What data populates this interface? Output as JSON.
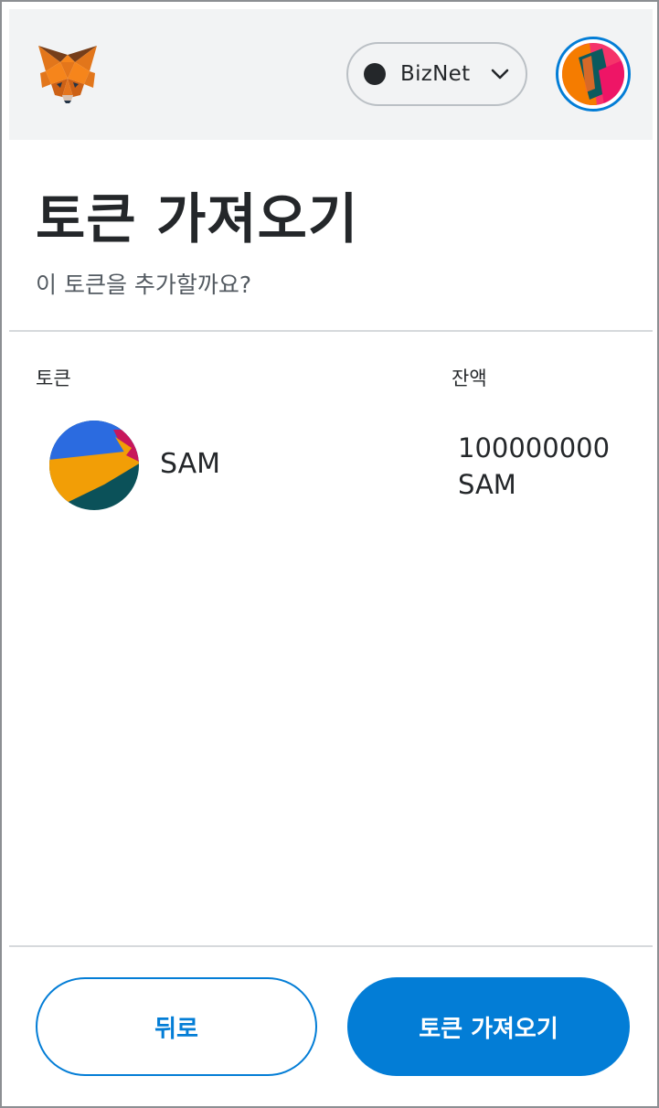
{
  "header": {
    "network": {
      "name": "BizNet",
      "dot_color": "#24272a"
    }
  },
  "page": {
    "title": "토큰 가져오기",
    "subtitle": "이 토큰을 추가할까요?"
  },
  "table": {
    "columns": [
      "토큰",
      "잔액"
    ],
    "rows": [
      {
        "symbol": "SAM",
        "balance": "100000000 SAM"
      }
    ]
  },
  "footer": {
    "back_label": "뒤로",
    "import_label": "토큰 가져오기"
  },
  "colors": {
    "accent": "#037dd6",
    "text": "#24272a",
    "header_bg": "#f2f3f4"
  }
}
